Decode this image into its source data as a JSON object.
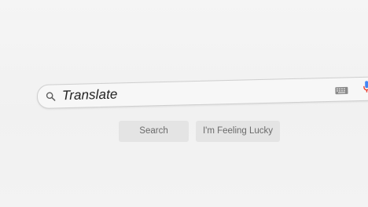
{
  "search": {
    "query": "Translate"
  },
  "buttons": {
    "search_label": "Search",
    "lucky_label": "I'm Feeling Lucky"
  },
  "icons": {
    "search": "search-icon",
    "keyboard": "keyboard-icon",
    "mic": "mic-icon"
  },
  "colors": {
    "mic_blue": "#4285f4",
    "mic_red": "#ea4335"
  }
}
